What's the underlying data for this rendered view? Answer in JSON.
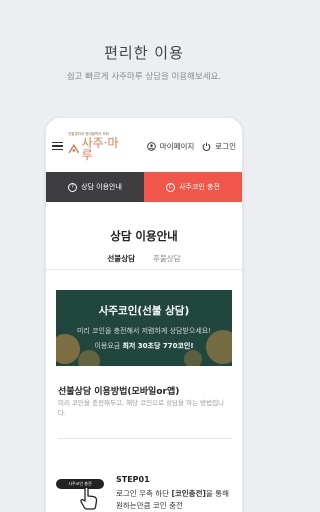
{
  "promo": {
    "title": "편리한 이용",
    "subtitle": "쉽고 빠르게 사주마루 상담을 이용해보세요."
  },
  "app": {
    "logo_tagline": "전통명리와 현대철학의 조화",
    "logo_text": "사주·마루",
    "mypage_label": "마이페이지",
    "login_label": "로그인"
  },
  "top_tabs": {
    "guide_label": "상담 이용안내",
    "coin_label": "사주코인 충전",
    "guide_icon": "?",
    "coin_icon": "C"
  },
  "main": {
    "title": "상담 이용안내",
    "tabs": [
      {
        "label": "선불상담",
        "active": true
      },
      {
        "label": "후불상담",
        "active": false
      }
    ]
  },
  "banner": {
    "title": "사주코인(선불 상담)",
    "line1": "미리 코인을 충전해서 저렴하게 상담받으세요!",
    "line2_prefix": "이용요금",
    "line2_strong": "최저 30초당 770코인!"
  },
  "method": {
    "title": "선불상담 이용방법(모바일or앱)",
    "desc": "미리 코인을 충전해두고, 해당 코인으로 상담을 하는 방법입니다."
  },
  "step1": {
    "pill": "사주코인 충전",
    "title": "STEP01",
    "text_prefix": "로그인 우측 하단 ",
    "text_strong": "[코인충전]",
    "text_suffix": "을 통해 원하는만큼 코인 충전"
  },
  "colors": {
    "accent_red": "#f0574a",
    "dark_tab": "#3d3d40",
    "banner_green": "#20463d",
    "logo_orange": "#d77a4f"
  }
}
